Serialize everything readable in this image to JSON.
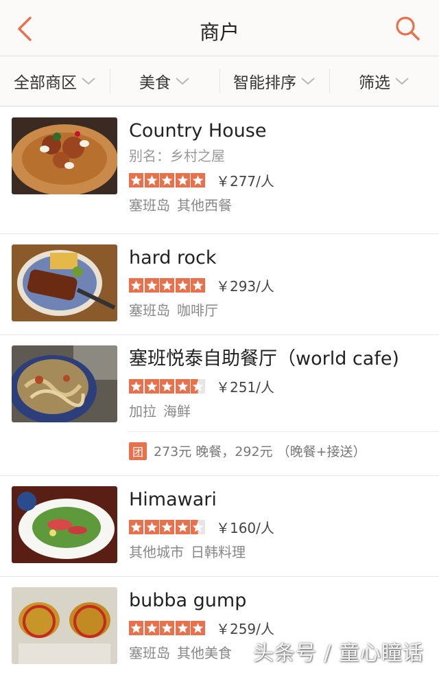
{
  "header": {
    "title": "商户",
    "back_icon": "chevron-left-icon",
    "search_icon": "search-icon",
    "accent": "#e8704b"
  },
  "filters": [
    {
      "label": "全部商区"
    },
    {
      "label": "美食"
    },
    {
      "label": "智能排序"
    },
    {
      "label": "筛选"
    }
  ],
  "merchants": [
    {
      "name": "Country House",
      "alias": "别名：乡村之屋",
      "rating": 5,
      "price": "￥277/人",
      "area": "塞班岛",
      "category": "其他西餐"
    },
    {
      "name": "hard rock",
      "rating": 5,
      "price": "￥293/人",
      "area": "塞班岛",
      "category": "咖啡厅"
    },
    {
      "name": "塞班悦泰自助餐厅（world cafe)",
      "rating": 4.5,
      "price": "￥251/人",
      "area": "加拉",
      "category": "海鲜",
      "deal": {
        "badge": "团",
        "text": "273元 晚餐，292元 （晚餐+接送）"
      }
    },
    {
      "name": "Himawari",
      "rating": 4.5,
      "price": "￥160/人",
      "area": "其他城市",
      "category": "日韩料理"
    },
    {
      "name": "bubba gump",
      "rating": 5,
      "price": "￥259/人",
      "area": "塞班岛",
      "category": "其他美食"
    }
  ],
  "watermark": "头条号 / 童心瞳话",
  "colors": {
    "star": "#e8704b",
    "divider": "#e6e6e6",
    "nav_bg": "#fbfaf9"
  }
}
